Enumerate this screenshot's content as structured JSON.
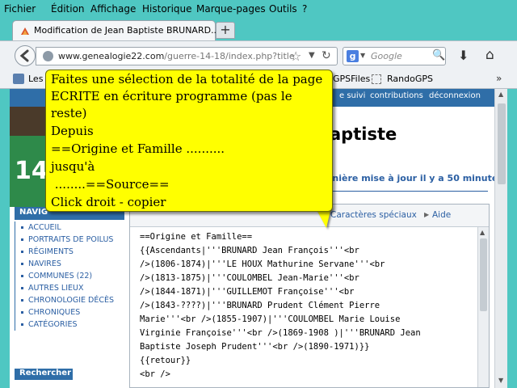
{
  "menu": [
    "Fichier",
    "Édition",
    "Affichage",
    "Historique",
    "Marque-pages",
    "Outils",
    "?"
  ],
  "tab": {
    "title": "Modification de Jean Baptiste BRUNARD...",
    "new_tab": "+"
  },
  "navbar": {
    "url_domain": "www.genealogie22.com",
    "url_path": "/guerre-14-18/index.php?title",
    "search_placeholder": "Google"
  },
  "bookmarks": {
    "first": "Les",
    "second": "GPSFiles",
    "third": "RandoGPS",
    "more": "»"
  },
  "page_header": {
    "links": [
      "e suivi",
      "contributions",
      "déconnexion"
    ]
  },
  "logo": {
    "number": "14"
  },
  "sidebar": {
    "heading": "NAVIG",
    "items": [
      "ACCUEIL",
      "PORTRAITS DE POILUS",
      "RÉGIMENTS",
      "NAVIRES",
      "COMMUNES (22)",
      "AUTRES LIEUX",
      "CHRONOLOGIE DÉCÈS",
      "CHRONIQUES",
      "CATÉGORIES"
    ],
    "search_heading": "Rechercher"
  },
  "main": {
    "title": "aptiste",
    "subtitle": "rnière mise à jour il y a 50 minutes"
  },
  "editor": {
    "toolbar_chars": "Caractères spéciaux",
    "toolbar_help": "Aide",
    "lines": [
      "==Origine et Famille==",
      "{{Ascendants|'''BRUNARD Jean François'''<br",
      "/>(1806-1874)|'''LE HOUX Mathurine Servane'''<br",
      "/>(1813-1875)|'''COULOMBEL Jean-Marie'''<br",
      "/>(1844-1871)|'''GUILLEMOT Françoise'''<br",
      "/>(1843-????)|'''BRUNARD Prudent Clément Pierre",
      "Marie'''<br />(1855-1907)|'''COULOMBEL Marie Louise",
      "Virginie Françoise'''<br />(1869-1908 )|'''BRUNARD Jean",
      "Baptiste Joseph Prudent'''<br />(1890-1971)}}",
      "{{retour}}",
      "<br />"
    ]
  },
  "callout": {
    "lines": [
      "Faites une sélection de la totalité de la page",
      "ECRITE en écriture programme (pas le",
      "reste)",
      "Depuis",
      "==Origine et Famille ..........",
      "jusqu'à",
      " ........==Source==",
      "Click droit - copier"
    ]
  }
}
